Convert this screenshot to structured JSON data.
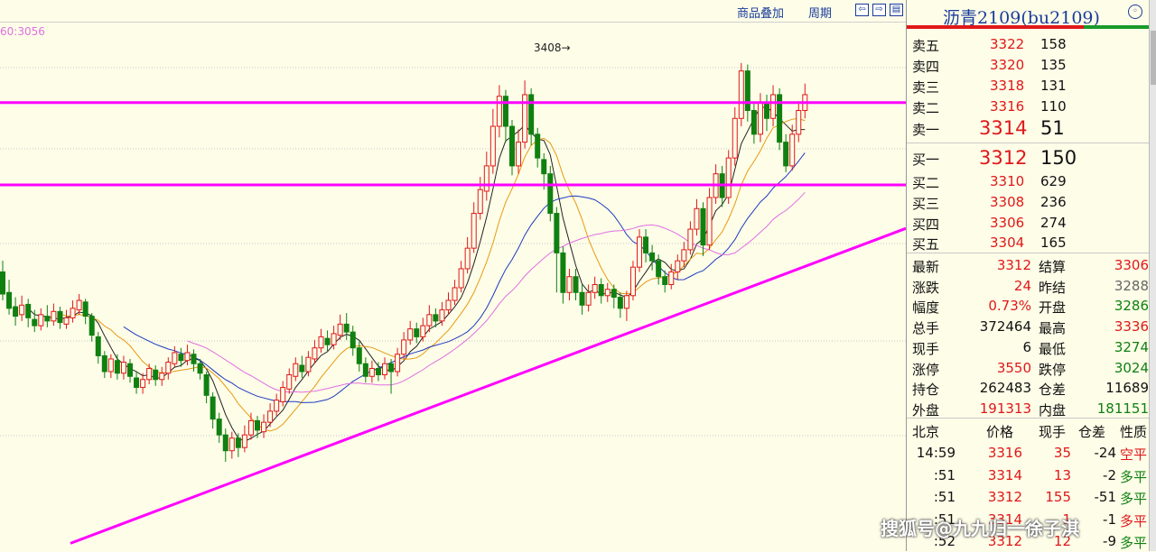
{
  "toolbar": {
    "overlay": "商品叠加",
    "period": "周期"
  },
  "chart": {
    "ma_label": "60:3056",
    "max_label": "3408",
    "colors": {
      "up": "#e01818",
      "down": "#108010",
      "ma5": "#222222",
      "ma10": "#e89a10",
      "ma20": "#203ac0",
      "ma60": "#e070e0",
      "line": "#ff00ff"
    }
  },
  "chart_data": {
    "type": "candlestick",
    "ylim": [
      2820,
      3480
    ],
    "price_ticks": [],
    "x_index_range": [
      0,
      155
    ],
    "candles": [
      [
        0,
        3166,
        3138,
        3180,
        3130
      ],
      [
        1,
        3140,
        3120,
        3156,
        3112
      ],
      [
        2,
        3122,
        3110,
        3134,
        3098
      ],
      [
        3,
        3112,
        3124,
        3136,
        3104
      ],
      [
        4,
        3125,
        3108,
        3132,
        3096
      ],
      [
        5,
        3106,
        3098,
        3118,
        3090
      ],
      [
        6,
        3098,
        3112,
        3120,
        3092
      ],
      [
        7,
        3110,
        3104,
        3124,
        3096
      ],
      [
        8,
        3104,
        3116,
        3126,
        3098
      ],
      [
        9,
        3116,
        3102,
        3122,
        3094
      ],
      [
        10,
        3100,
        3108,
        3118,
        3094
      ],
      [
        11,
        3108,
        3120,
        3130,
        3102
      ],
      [
        12,
        3118,
        3130,
        3138,
        3112
      ],
      [
        13,
        3128,
        3110,
        3132,
        3100
      ],
      [
        14,
        3110,
        3086,
        3114,
        3078
      ],
      [
        15,
        3084,
        3060,
        3090,
        3050
      ],
      [
        16,
        3060,
        3040,
        3066,
        3032
      ],
      [
        17,
        3040,
        3056,
        3062,
        3032
      ],
      [
        18,
        3054,
        3038,
        3062,
        3030
      ],
      [
        19,
        3038,
        3052,
        3060,
        3030
      ],
      [
        20,
        3050,
        3034,
        3056,
        3026
      ],
      [
        21,
        3032,
        3020,
        3040,
        3012
      ],
      [
        22,
        3020,
        3030,
        3038,
        3012
      ],
      [
        23,
        3030,
        3044,
        3050,
        3024
      ],
      [
        24,
        3042,
        3030,
        3048,
        3022
      ],
      [
        25,
        3030,
        3038,
        3046,
        3022
      ],
      [
        26,
        3038,
        3052,
        3058,
        3030
      ],
      [
        27,
        3050,
        3064,
        3072,
        3046
      ],
      [
        28,
        3062,
        3054,
        3070,
        3046
      ],
      [
        29,
        3054,
        3064,
        3074,
        3048
      ],
      [
        30,
        3062,
        3050,
        3068,
        3040
      ],
      [
        31,
        3050,
        3038,
        3056,
        3030
      ],
      [
        32,
        3036,
        3010,
        3040,
        3000
      ],
      [
        33,
        3008,
        2980,
        3014,
        2968
      ],
      [
        34,
        2980,
        2960,
        2988,
        2950
      ],
      [
        35,
        2960,
        2940,
        2968,
        2926
      ],
      [
        36,
        2940,
        2956,
        2964,
        2930
      ],
      [
        37,
        2956,
        2944,
        2962,
        2932
      ],
      [
        38,
        2944,
        2960,
        2972,
        2938
      ],
      [
        39,
        2960,
        2978,
        2988,
        2954
      ],
      [
        40,
        2978,
        2966,
        2984,
        2956
      ],
      [
        41,
        2964,
        2976,
        2986,
        2956
      ],
      [
        42,
        2976,
        2990,
        3000,
        2970
      ],
      [
        43,
        2990,
        3004,
        3012,
        2984
      ],
      [
        44,
        3002,
        3020,
        3028,
        2996
      ],
      [
        45,
        3018,
        3036,
        3044,
        3012
      ],
      [
        46,
        3034,
        3050,
        3058,
        3028
      ],
      [
        47,
        3048,
        3040,
        3060,
        3032
      ],
      [
        48,
        3040,
        3058,
        3066,
        3034
      ],
      [
        49,
        3056,
        3070,
        3080,
        3050
      ],
      [
        50,
        3070,
        3084,
        3094,
        3064
      ],
      [
        51,
        3082,
        3074,
        3092,
        3066
      ],
      [
        52,
        3074,
        3088,
        3098,
        3068
      ],
      [
        53,
        3086,
        3100,
        3112,
        3080
      ],
      [
        54,
        3100,
        3090,
        3114,
        3080
      ],
      [
        55,
        3090,
        3070,
        3098,
        3060
      ],
      [
        56,
        3070,
        3050,
        3078,
        3040
      ],
      [
        57,
        3050,
        3034,
        3058,
        3026
      ],
      [
        58,
        3034,
        3044,
        3054,
        3026
      ],
      [
        59,
        3044,
        3036,
        3052,
        3028
      ],
      [
        60,
        3036,
        3050,
        3058,
        3030
      ],
      [
        61,
        3050,
        3040,
        3056,
        3012
      ],
      [
        62,
        3040,
        3062,
        3070,
        3034
      ],
      [
        63,
        3062,
        3080,
        3090,
        3056
      ],
      [
        64,
        3080,
        3094,
        3104,
        3074
      ],
      [
        65,
        3094,
        3084,
        3102,
        3076
      ],
      [
        66,
        3084,
        3098,
        3108,
        3078
      ],
      [
        67,
        3098,
        3112,
        3124,
        3090
      ],
      [
        68,
        3112,
        3104,
        3120,
        3096
      ],
      [
        69,
        3104,
        3118,
        3128,
        3098
      ],
      [
        70,
        3118,
        3130,
        3140,
        3112
      ],
      [
        71,
        3130,
        3146,
        3156,
        3124
      ],
      [
        72,
        3146,
        3170,
        3180,
        3140
      ],
      [
        73,
        3170,
        3196,
        3210,
        3164
      ],
      [
        74,
        3196,
        3240,
        3254,
        3190
      ],
      [
        75,
        3240,
        3270,
        3286,
        3232
      ],
      [
        76,
        3268,
        3300,
        3318,
        3256
      ],
      [
        77,
        3300,
        3350,
        3372,
        3290
      ],
      [
        78,
        3350,
        3388,
        3402,
        3336
      ],
      [
        79,
        3388,
        3350,
        3396,
        3330
      ],
      [
        80,
        3350,
        3300,
        3358,
        3288
      ],
      [
        81,
        3300,
        3330,
        3346,
        3290
      ],
      [
        82,
        3330,
        3390,
        3408,
        3322
      ],
      [
        83,
        3390,
        3340,
        3398,
        3326
      ],
      [
        84,
        3340,
        3310,
        3348,
        3298
      ],
      [
        85,
        3308,
        3290,
        3316,
        3270
      ],
      [
        86,
        3290,
        3240,
        3300,
        3230
      ],
      [
        87,
        3240,
        3190,
        3248,
        3140
      ],
      [
        88,
        3190,
        3140,
        3198,
        3126
      ],
      [
        89,
        3140,
        3160,
        3170,
        3130
      ],
      [
        90,
        3160,
        3140,
        3170,
        3130
      ],
      [
        91,
        3140,
        3124,
        3150,
        3112
      ],
      [
        92,
        3124,
        3140,
        3150,
        3116
      ],
      [
        93,
        3140,
        3150,
        3160,
        3132
      ],
      [
        94,
        3150,
        3136,
        3158,
        3126
      ],
      [
        95,
        3136,
        3144,
        3152,
        3128
      ],
      [
        96,
        3144,
        3134,
        3150,
        3120
      ],
      [
        97,
        3134,
        3120,
        3140,
        3108
      ],
      [
        98,
        3120,
        3136,
        3142,
        3104
      ],
      [
        99,
        3136,
        3172,
        3180,
        3130
      ],
      [
        100,
        3172,
        3210,
        3220,
        3166
      ],
      [
        101,
        3210,
        3190,
        3220,
        3178
      ],
      [
        102,
        3190,
        3180,
        3200,
        3168
      ],
      [
        103,
        3180,
        3160,
        3188,
        3150
      ],
      [
        104,
        3160,
        3150,
        3168,
        3140
      ],
      [
        105,
        3150,
        3166,
        3176,
        3144
      ],
      [
        106,
        3166,
        3180,
        3188,
        3156
      ],
      [
        107,
        3180,
        3194,
        3204,
        3172
      ],
      [
        108,
        3194,
        3220,
        3230,
        3188
      ],
      [
        109,
        3220,
        3246,
        3258,
        3212
      ],
      [
        110,
        3246,
        3200,
        3254,
        3186
      ],
      [
        111,
        3200,
        3260,
        3272,
        3194
      ],
      [
        112,
        3260,
        3290,
        3302,
        3252
      ],
      [
        113,
        3290,
        3260,
        3300,
        3248
      ],
      [
        114,
        3260,
        3310,
        3320,
        3252
      ],
      [
        115,
        3310,
        3360,
        3374,
        3300
      ],
      [
        116,
        3360,
        3420,
        3430,
        3350
      ],
      [
        117,
        3420,
        3370,
        3428,
        3356
      ],
      [
        118,
        3370,
        3340,
        3380,
        3328
      ],
      [
        119,
        3340,
        3380,
        3392,
        3330
      ],
      [
        120,
        3380,
        3360,
        3390,
        3344
      ],
      [
        121,
        3360,
        3390,
        3402,
        3350
      ],
      [
        122,
        3390,
        3330,
        3398,
        3320
      ],
      [
        123,
        3330,
        3300,
        3340,
        3292
      ],
      [
        124,
        3300,
        3340,
        3352,
        3294
      ],
      [
        125,
        3340,
        3370,
        3382,
        3330
      ],
      [
        126,
        3370,
        3390,
        3404,
        3360
      ]
    ],
    "annotations": []
  },
  "panel": {
    "title": "沥青2109(bu2109)",
    "asks": [
      {
        "label": "卖五",
        "price": "3322",
        "vol": "158"
      },
      {
        "label": "卖四",
        "price": "3320",
        "vol": "135"
      },
      {
        "label": "卖三",
        "price": "3318",
        "vol": "131"
      },
      {
        "label": "卖二",
        "price": "3316",
        "vol": "110"
      },
      {
        "label": "卖一",
        "price": "3314",
        "vol": "51"
      }
    ],
    "bids": [
      {
        "label": "买一",
        "price": "3312",
        "vol": "150"
      },
      {
        "label": "买二",
        "price": "3310",
        "vol": "629"
      },
      {
        "label": "买三",
        "price": "3308",
        "vol": "236"
      },
      {
        "label": "买四",
        "price": "3306",
        "vol": "274"
      },
      {
        "label": "买五",
        "price": "3304",
        "vol": "165"
      }
    ],
    "stats": [
      {
        "l1": "最新",
        "v1": "3312",
        "c1": "red",
        "l2": "结算",
        "v2": "3306",
        "c2": "red"
      },
      {
        "l1": "涨跌",
        "v1": "24",
        "c1": "red",
        "l2": "昨结",
        "v2": "3288",
        "c2": "gray"
      },
      {
        "l1": "幅度",
        "v1": "0.73%",
        "c1": "red",
        "l2": "开盘",
        "v2": "3286",
        "c2": "green"
      },
      {
        "l1": "总手",
        "v1": "372464",
        "c1": "dark",
        "l2": "最高",
        "v2": "3336",
        "c2": "red"
      },
      {
        "l1": "现手",
        "v1": "6",
        "c1": "dark",
        "l2": "最低",
        "v2": "3274",
        "c2": "green"
      },
      {
        "l1": "涨停",
        "v1": "3550",
        "c1": "red",
        "l2": "跌停",
        "v2": "3024",
        "c2": "green"
      },
      {
        "l1": "持仓",
        "v1": "262483",
        "c1": "dark",
        "l2": "仓差",
        "v2": "11689",
        "c2": "dark"
      },
      {
        "l1": "外盘",
        "v1": "191313",
        "c1": "red",
        "l2": "内盘",
        "v2": "181151",
        "c2": "green"
      }
    ],
    "ticks_header": {
      "time": "北京",
      "price": "价格",
      "vol": "现手",
      "oi": "仓差",
      "type": "性质"
    },
    "ticks": [
      {
        "time": "14:59",
        "price": "3316",
        "vol": "35",
        "oi": "-24",
        "type": "空平",
        "pc": "red",
        "tc": "red"
      },
      {
        "time": ":51",
        "price": "3314",
        "vol": "13",
        "oi": "-2",
        "type": "多平",
        "pc": "red",
        "tc": "green"
      },
      {
        "time": ":51",
        "price": "3312",
        "vol": "155",
        "oi": "-51",
        "type": "多平",
        "pc": "red",
        "tc": "green"
      },
      {
        "time": ":51",
        "price": "3314",
        "vol": "1",
        "oi": "-1",
        "type": "多平",
        "pc": "red",
        "tc": "red"
      },
      {
        "time": ":52",
        "price": "3312",
        "vol": "12",
        "oi": "-9",
        "type": "多平",
        "pc": "red",
        "tc": "green"
      }
    ]
  },
  "watermark": "搜狐号@九九归一徐子淇"
}
